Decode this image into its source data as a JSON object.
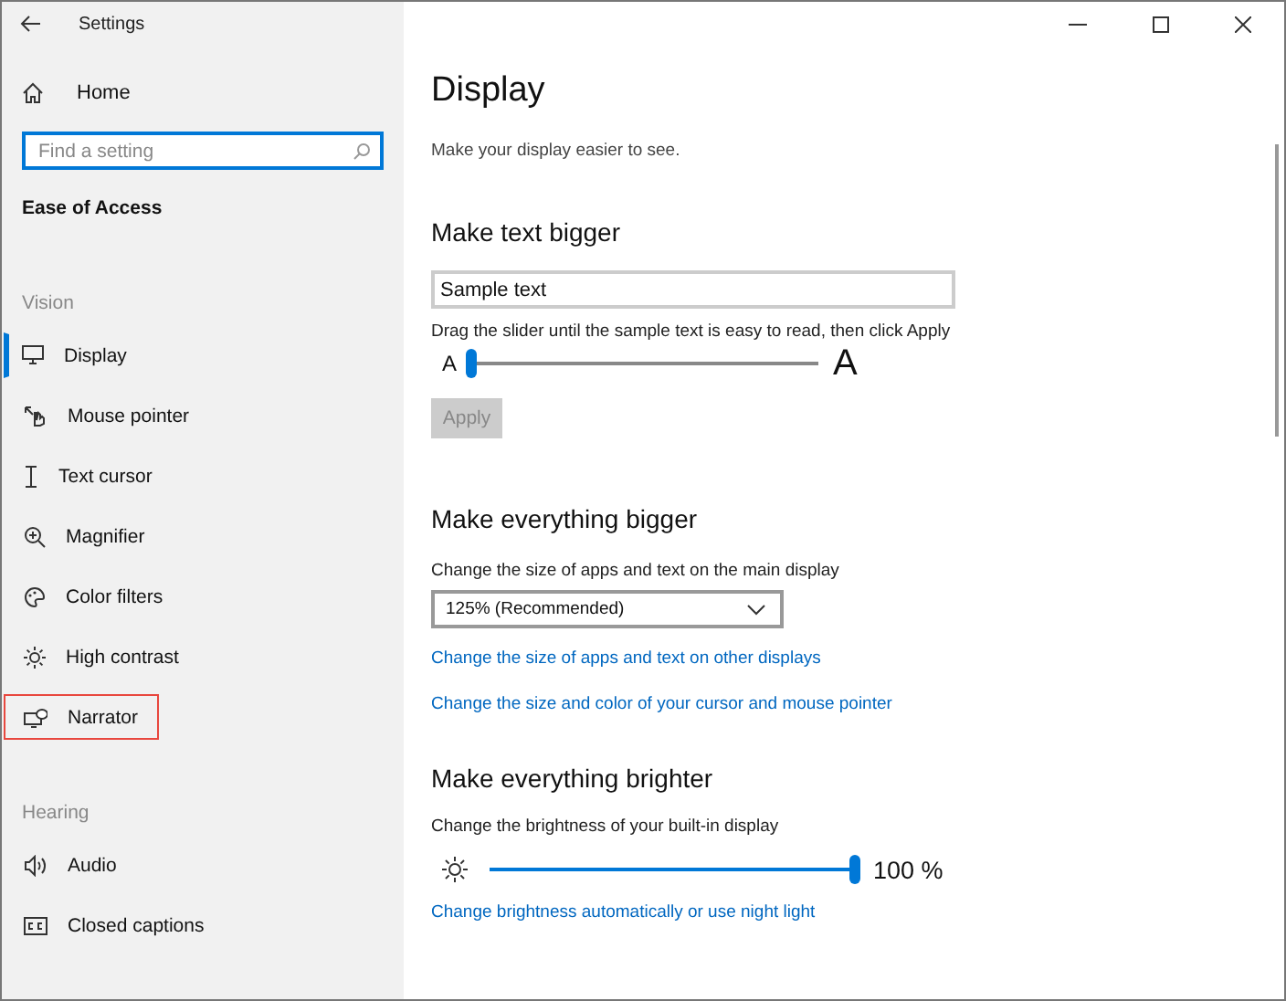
{
  "window": {
    "title": "Settings"
  },
  "sidebar": {
    "home": "Home",
    "search": {
      "placeholder": "Find a setting"
    },
    "heading": "Ease of Access",
    "groups": [
      {
        "label": "Vision",
        "items": [
          {
            "label": "Display",
            "selected": true,
            "highlighted": false
          },
          {
            "label": "Mouse pointer",
            "selected": false,
            "highlighted": false
          },
          {
            "label": "Text cursor",
            "selected": false,
            "highlighted": false
          },
          {
            "label": "Magnifier",
            "selected": false,
            "highlighted": false
          },
          {
            "label": "Color filters",
            "selected": false,
            "highlighted": false
          },
          {
            "label": "High contrast",
            "selected": false,
            "highlighted": false
          },
          {
            "label": "Narrator",
            "selected": false,
            "highlighted": true
          }
        ]
      },
      {
        "label": "Hearing",
        "items": [
          {
            "label": "Audio",
            "selected": false,
            "highlighted": false
          },
          {
            "label": "Closed captions",
            "selected": false,
            "highlighted": false
          }
        ]
      }
    ]
  },
  "page": {
    "title": "Display",
    "subtitle": "Make your display easier to see.",
    "text_size": {
      "heading": "Make text bigger",
      "sample": "Sample text",
      "hint": "Drag the slider until the sample text is easy to read, then click Apply",
      "small_label": "A",
      "large_label": "A",
      "level": 0,
      "apply": {
        "label": "Apply",
        "disabled": true
      }
    },
    "scale": {
      "heading": "Make everything bigger",
      "label": "Change the size of apps and text on the main display",
      "dropdown": "125% (Recommended)",
      "links": [
        "Change the size of apps and text on other displays",
        "Change the size and color of your cursor and mouse pointer"
      ]
    },
    "brightness": {
      "heading": "Make everything brighter",
      "label": "Change the brightness of your built-in display",
      "level": 1,
      "reading": "100 %",
      "link": "Change brightness automatically or use night light"
    }
  }
}
